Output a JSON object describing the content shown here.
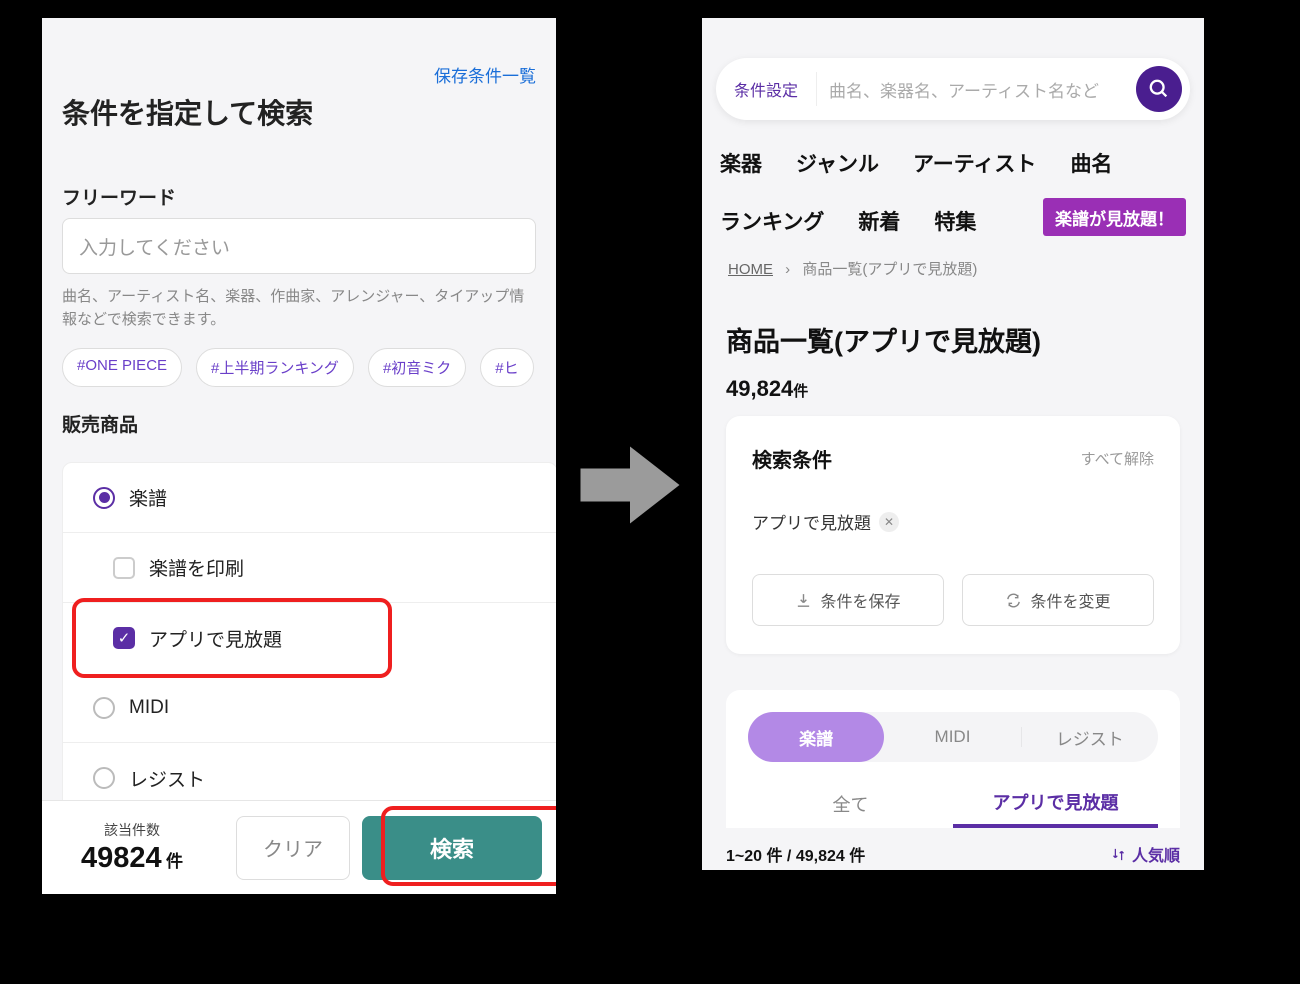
{
  "left": {
    "saved_link": "保存条件一覧",
    "title": "条件を指定して検索",
    "freeword_label": "フリーワード",
    "freeword_placeholder": "入力してください",
    "freeword_help": "曲名、アーティスト名、楽器、作曲家、アレンジャー、タイアップ情報などで検索できます。",
    "tags": [
      "#ONE PIECE",
      "#上半期ランキング",
      "#初音ミク",
      "#ヒ"
    ],
    "section_label": "販売商品",
    "options": {
      "gakufu": "楽譜",
      "print": "楽譜を印刷",
      "app": "アプリで見放題",
      "midi": "MIDI",
      "regist": "レジスト"
    },
    "footer": {
      "count_label": "該当件数",
      "count_value": "49824",
      "count_unit": "件",
      "clear": "クリア",
      "search": "検索"
    }
  },
  "right": {
    "cond_label": "条件設定",
    "search_placeholder": "曲名、楽器名、アーティスト名など",
    "nav": [
      "楽器",
      "ジャンル",
      "アーティスト",
      "曲名",
      "ランキング",
      "新着",
      "特集"
    ],
    "promo": "楽譜が見放題！",
    "breadcrumb": {
      "home": "HOME",
      "current": "商品一覧(アプリで見放題)"
    },
    "page_title": "商品一覧(アプリで見放題)",
    "result_count": "49,824",
    "result_unit": "件",
    "cond": {
      "title": "検索条件",
      "clear": "すべて解除",
      "chip": "アプリで見放題",
      "save": "条件を保存",
      "change": "条件を変更"
    },
    "seg": [
      "楽譜",
      "MIDI",
      "レジスト"
    ],
    "tabs": [
      "全て",
      "アプリで見放題"
    ],
    "range": "1~20 件 / 49,824 件",
    "sort": "人気順"
  }
}
